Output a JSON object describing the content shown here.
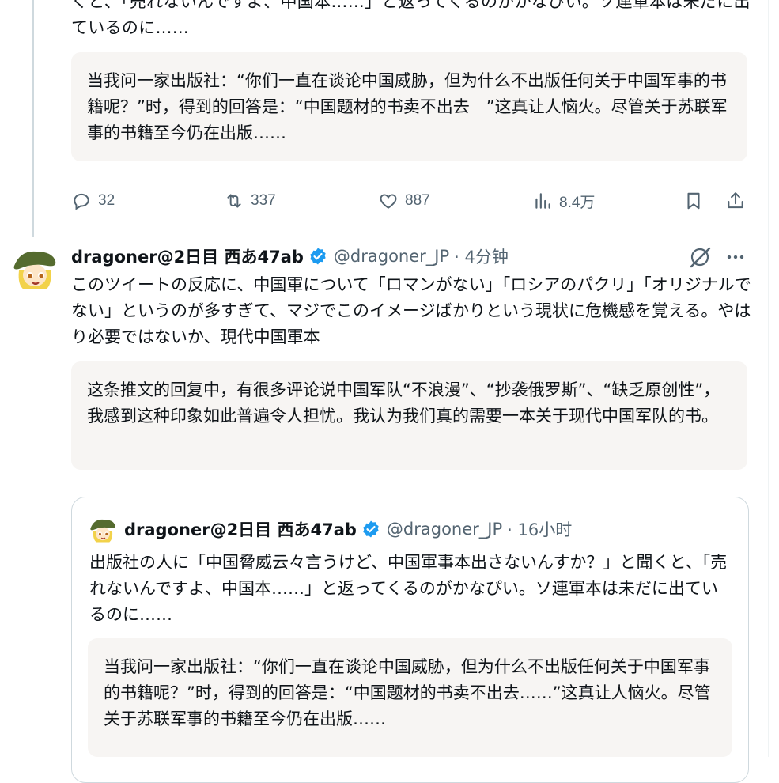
{
  "tweet1": {
    "text": "くと、「売れないんですよ、中国本……」と返ってくるのがかなぴい。ソ連軍本は未だに出ているのに……",
    "translation": "当我问一家出版社：“你们一直在谈论中国威胁，但为什么不出版任何关于中国军事的书籍呢？”时，得到的回答是：“中国题材的书卖不出去　”这真让人恼火。尽管关于苏联军事的书籍至今仍在出版……",
    "actions": {
      "replies": "32",
      "retweets": "337",
      "likes": "887",
      "views": "8.4万"
    }
  },
  "tweet2": {
    "author": "dragoner@2日目 西あ47ab",
    "handle": "@dragoner_JP",
    "time": "· 4分钟",
    "text": "このツイートの反応に、中国軍について「ロマンがない」「ロシアのパクリ」「オリジナルでない」というのが多すぎて、マジでこのイメージばかりという現状に危機感を覚える。やはり必要ではないか、現代中国軍本",
    "translation": "这条推文的回复中，有很多评论说中国军队“不浪漫”、“抄袭俄罗斯”、“缺乏原创性”，我感到这种印象如此普遍令人担忧。我认为我们真的需要一本关于现代中国军队的书。"
  },
  "quote": {
    "author": "dragoner@2日目 西あ47ab",
    "handle": "@dragoner_JP",
    "time": "· 16小时",
    "text": "出版社の人に「中国脅威云々言うけど、中国軍事本出さないんすか？」と聞くと、「売れないんですよ、中国本……」と返ってくるのがかなぴい。ソ連軍本は未だに出ているのに……",
    "translation": "当我问一家出版社：“你们一直在谈论中国威胁，但为什么不出版任何关于中国军事的书籍呢？”时，得到的回答是：“中国题材的书卖不出去……”这真让人恼火。尽管关于苏联军事的书籍至今仍在出版……"
  },
  "colors": {
    "text": "#0f1419",
    "secondary": "#536471",
    "verified": "#1d9bf0",
    "translation_bg": "#f7f5f3",
    "border": "#cfd9de"
  }
}
